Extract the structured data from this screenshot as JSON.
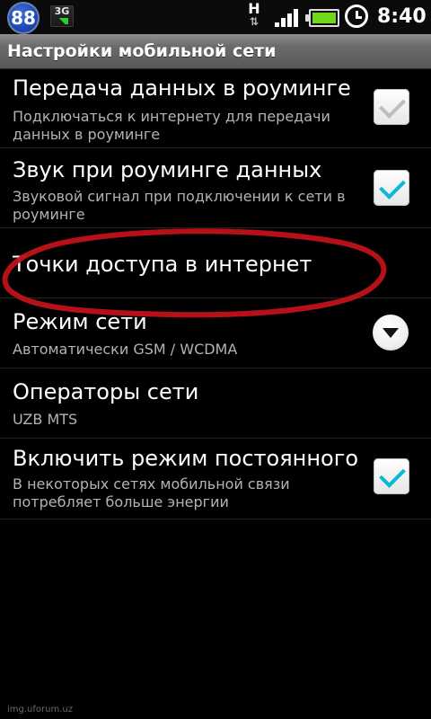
{
  "status_bar": {
    "badge": "88",
    "network_3g": "3G",
    "network_type": "H",
    "time": "8:40",
    "icons": [
      "notification-badge-icon",
      "3g-icon",
      "data-arrows-icon",
      "signal-icon",
      "battery-icon",
      "alarm-icon"
    ]
  },
  "header": {
    "title": "Настройки мобильной сети"
  },
  "items": [
    {
      "title": "Передача данных в роуминге",
      "summary": "Подключаться к интернету для передачи данных в роуминге",
      "checked": false
    },
    {
      "title": "Звук при роуминге данных",
      "summary": "Звуковой сигнал при подключении к сети в роуминге",
      "checked": true
    },
    {
      "title": "Точки доступа в интернет"
    },
    {
      "title": "Режим сети",
      "summary": "Автоматически GSM / WCDMA"
    },
    {
      "title": "Операторы сети",
      "summary": "UZB MTS"
    },
    {
      "title": "Включить режим постоянного п",
      "summary": "В некоторых сетях мобильной связи потребляет больше энергии",
      "checked": true
    }
  ],
  "watermark": "img.uforum.uz",
  "colors": {
    "accent_check": "#0bb8d8",
    "annotation_red": "#c0121a",
    "battery_green": "#6fd81b"
  }
}
